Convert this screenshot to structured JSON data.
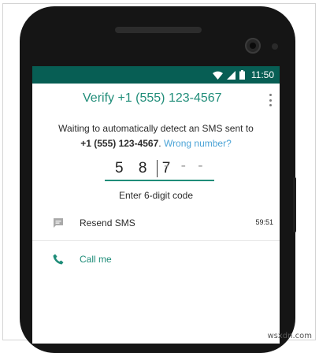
{
  "status_bar": {
    "time": "11:50",
    "icons": [
      "wifi-icon",
      "signal-icon",
      "battery-icon"
    ]
  },
  "header": {
    "title": "Verify +1 (555) 123-4567",
    "menu_icon": "more-vert-icon"
  },
  "message": {
    "line1": "Waiting to automatically detect an SMS sent to",
    "phone": "+1 (555) 123-4567",
    "wrong_number": "Wrong number?"
  },
  "code_input": {
    "value": "5 8 7",
    "placeholder": "- - -",
    "label": "Enter 6-digit code"
  },
  "actions": {
    "resend_sms": {
      "label": "Resend SMS",
      "timer": "59:51",
      "icon": "message-icon"
    },
    "call_me": {
      "label": "Call me",
      "icon": "phone-icon"
    }
  },
  "watermark": "wsxdn.com",
  "colors": {
    "status_bar": "#075e54",
    "accent": "#208d79",
    "link": "#4ba3d6"
  }
}
